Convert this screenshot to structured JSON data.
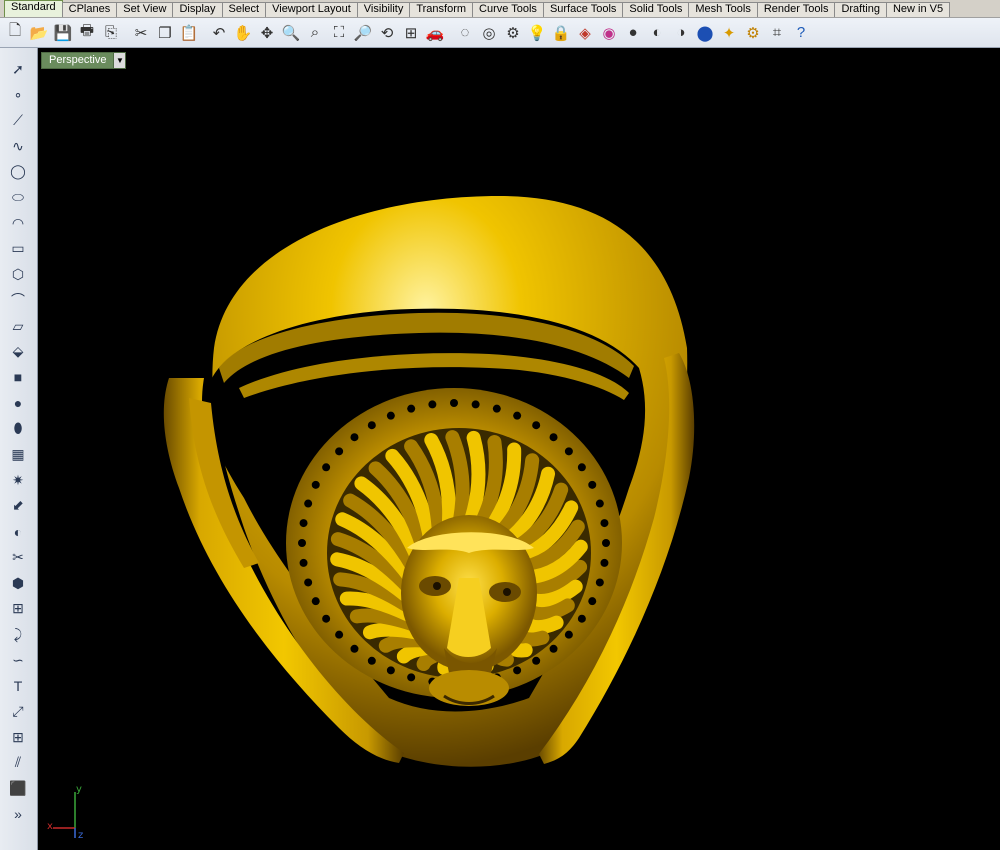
{
  "tabs": [
    "Standard",
    "CPlanes",
    "Set View",
    "Display",
    "Select",
    "Viewport Layout",
    "Visibility",
    "Transform",
    "Curve Tools",
    "Surface Tools",
    "Solid Tools",
    "Mesh Tools",
    "Render Tools",
    "Drafting",
    "New in V5"
  ],
  "active_tab": "Standard",
  "toolbar_icons": [
    "new-file-icon",
    "open-folder-icon",
    "save-icon",
    "print-icon",
    "import-icon",
    "cut-icon",
    "copy-icon",
    "paste-icon",
    "undo-icon",
    "pan-hand-icon",
    "rotate-view-icon",
    "zoom-icon",
    "zoom-window-icon",
    "zoom-extents-icon",
    "zoom-selected-icon",
    "undo-view-icon",
    "four-viewports-icon",
    "car-options-icon",
    "hide-objects-icon",
    "show-objects-icon",
    "lock-objects-icon",
    "light-bulb-icon",
    "lock-icon",
    "layer-icon",
    "color-wheel-icon",
    "render-sphere-icon",
    "shaded-sphere-icon",
    "rendered-sphere-icon",
    "blue-sphere-icon",
    "render-light-icon",
    "gear-settings-icon",
    "dimension-icon",
    "help-icon"
  ],
  "left_icons": [
    "select-arrow-icon",
    "point-icon",
    "polyline-icon",
    "curve-icon",
    "circle-icon",
    "ellipse-icon",
    "arc-icon",
    "rectangle-icon",
    "polygon-icon",
    "fillet-icon",
    "surface-icon",
    "extrude-icon",
    "box-icon",
    "sphere-icon",
    "cylinder-icon",
    "mesh-icon",
    "explode-icon",
    "transform-icon",
    "boolean-icon",
    "split-icon",
    "union-icon",
    "group-icon",
    "bend-icon",
    "twist-icon",
    "text-icon",
    "scale-icon",
    "array-icon",
    "mirror-icon",
    "block-icon",
    "more-tools-icon"
  ],
  "viewport": {
    "name": "Perspective",
    "dropdown_glyph": "▼"
  },
  "axis": {
    "x": "x",
    "y": "y",
    "z": "z"
  },
  "colors": {
    "gold": "#e3b500",
    "gold_dark": "#7a5a00",
    "viewport_bg": "#000000",
    "active_tab": "#e8f1dc"
  }
}
